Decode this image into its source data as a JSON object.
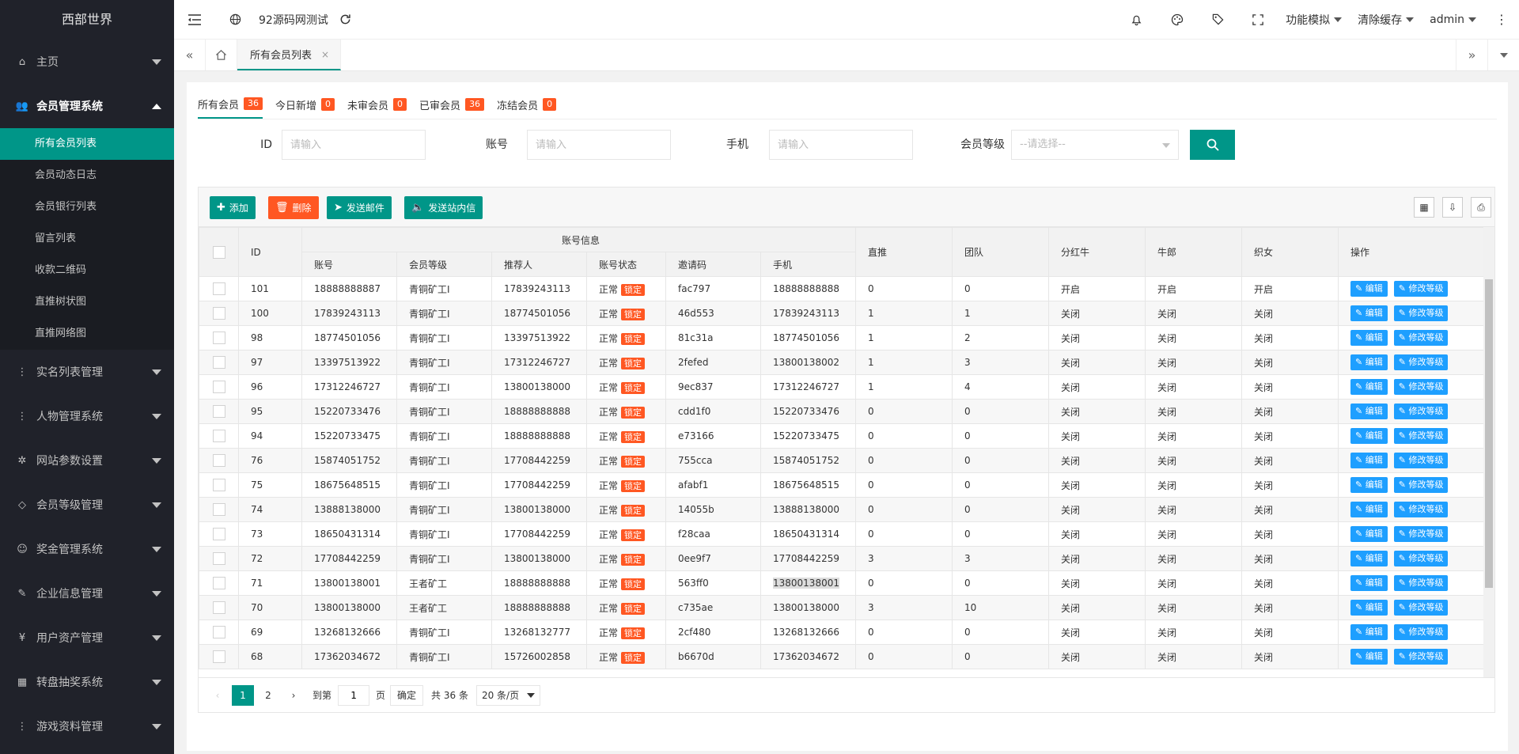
{
  "sidebar": {
    "logo": "西部世界",
    "items": [
      {
        "label": "主页",
        "icon": "home-icon",
        "glyph": "⌂"
      },
      {
        "label": "会员管理系统",
        "icon": "users-icon",
        "glyph": "👥",
        "open": true,
        "children": [
          "所有会员列表",
          "会员动态日志",
          "会员银行列表",
          "留言列表",
          "收款二维码",
          "直推树状图",
          "直推网络图"
        ]
      },
      {
        "label": "实名列表管理",
        "icon": "more-vertical-icon",
        "glyph": "⋮"
      },
      {
        "label": "人物管理系统",
        "icon": "more-vertical-icon",
        "glyph": "⋮"
      },
      {
        "label": "网站参数设置",
        "icon": "gear-icon",
        "glyph": "✲"
      },
      {
        "label": "会员等级管理",
        "icon": "diamond-icon",
        "glyph": "◇"
      },
      {
        "label": "奖金管理系统",
        "icon": "smile-icon",
        "glyph": "☺"
      },
      {
        "label": "企业信息管理",
        "icon": "edit-doc-icon",
        "glyph": "✎"
      },
      {
        "label": "用户资产管理",
        "icon": "yen-icon",
        "glyph": "¥"
      },
      {
        "label": "转盘抽奖系统",
        "icon": "apps-icon",
        "glyph": "▦"
      },
      {
        "label": "游戏资料管理",
        "icon": "more-vertical-icon",
        "glyph": "⋮"
      }
    ]
  },
  "header": {
    "site_title": "92源码网测试",
    "right": {
      "feature": "功能模拟",
      "clear_cache": "清除缓存",
      "user": "admin"
    }
  },
  "tabbar": {
    "active_tab": "所有会员列表",
    "close": "×"
  },
  "subtabs": [
    {
      "label": "所有会员",
      "count": "36"
    },
    {
      "label": "今日新增",
      "count": "0"
    },
    {
      "label": "未审会员",
      "count": "0"
    },
    {
      "label": "已审会员",
      "count": "36"
    },
    {
      "label": "冻结会员",
      "count": "0"
    }
  ],
  "search": {
    "id_label": "ID",
    "id_placeholder": "请输入",
    "account_label": "账号",
    "account_placeholder": "请输入",
    "phone_label": "手机",
    "phone_placeholder": "请输入",
    "level_label": "会员等级",
    "level_placeholder": "--请选择--"
  },
  "toolbar": {
    "add": "添加",
    "delete": "删除",
    "send_mail": "发送邮件",
    "send_msg": "发送站内信"
  },
  "table": {
    "group_header": "账号信息",
    "headers": {
      "id": "ID",
      "account": "账号",
      "level": "会员等级",
      "referrer": "推荐人",
      "status": "账号状态",
      "invite": "邀请码",
      "phone": "手机",
      "direct": "直推",
      "team": "团队",
      "bull": "分红牛",
      "herder": "牛郎",
      "weaver": "织女",
      "ops": "操作"
    },
    "lock_label": "锁定",
    "edit_label": "编辑",
    "level_edit_label": "修改等级",
    "rows": [
      {
        "id": "101",
        "account": "18888888887",
        "level": "青铜矿工I",
        "referrer": "17839243113",
        "status": "正常",
        "invite": "fac797",
        "phone": "18888888888",
        "direct": "0",
        "team": "0",
        "bull": "开启",
        "herder": "开启",
        "weaver": "开启"
      },
      {
        "id": "100",
        "account": "17839243113",
        "level": "青铜矿工I",
        "referrer": "18774501056",
        "status": "正常",
        "invite": "46d553",
        "phone": "17839243113",
        "direct": "1",
        "team": "1",
        "bull": "关闭",
        "herder": "关闭",
        "weaver": "关闭"
      },
      {
        "id": "98",
        "account": "18774501056",
        "level": "青铜矿工I",
        "referrer": "13397513922",
        "status": "正常",
        "invite": "81c31a",
        "phone": "18774501056",
        "direct": "1",
        "team": "2",
        "bull": "关闭",
        "herder": "关闭",
        "weaver": "关闭"
      },
      {
        "id": "97",
        "account": "13397513922",
        "level": "青铜矿工I",
        "referrer": "17312246727",
        "status": "正常",
        "invite": "2fefed",
        "phone": "13800138002",
        "direct": "1",
        "team": "3",
        "bull": "关闭",
        "herder": "关闭",
        "weaver": "关闭"
      },
      {
        "id": "96",
        "account": "17312246727",
        "level": "青铜矿工I",
        "referrer": "13800138000",
        "status": "正常",
        "invite": "9ec837",
        "phone": "17312246727",
        "direct": "1",
        "team": "4",
        "bull": "关闭",
        "herder": "关闭",
        "weaver": "关闭"
      },
      {
        "id": "95",
        "account": "15220733476",
        "level": "青铜矿工I",
        "referrer": "18888888888",
        "status": "正常",
        "invite": "cdd1f0",
        "phone": "15220733476",
        "direct": "0",
        "team": "0",
        "bull": "关闭",
        "herder": "关闭",
        "weaver": "关闭"
      },
      {
        "id": "94",
        "account": "15220733475",
        "level": "青铜矿工I",
        "referrer": "18888888888",
        "status": "正常",
        "invite": "e73166",
        "phone": "15220733475",
        "direct": "0",
        "team": "0",
        "bull": "关闭",
        "herder": "关闭",
        "weaver": "关闭"
      },
      {
        "id": "76",
        "account": "15874051752",
        "level": "青铜矿工I",
        "referrer": "17708442259",
        "status": "正常",
        "invite": "755cca",
        "phone": "15874051752",
        "direct": "0",
        "team": "0",
        "bull": "关闭",
        "herder": "关闭",
        "weaver": "关闭"
      },
      {
        "id": "75",
        "account": "18675648515",
        "level": "青铜矿工I",
        "referrer": "17708442259",
        "status": "正常",
        "invite": "afabf1",
        "phone": "18675648515",
        "direct": "0",
        "team": "0",
        "bull": "关闭",
        "herder": "关闭",
        "weaver": "关闭"
      },
      {
        "id": "74",
        "account": "13888138000",
        "level": "青铜矿工I",
        "referrer": "13800138000",
        "status": "正常",
        "invite": "14055b",
        "phone": "13888138000",
        "direct": "0",
        "team": "0",
        "bull": "关闭",
        "herder": "关闭",
        "weaver": "关闭"
      },
      {
        "id": "73",
        "account": "18650431314",
        "level": "青铜矿工I",
        "referrer": "17708442259",
        "status": "正常",
        "invite": "f28caa",
        "phone": "18650431314",
        "direct": "0",
        "team": "0",
        "bull": "关闭",
        "herder": "关闭",
        "weaver": "关闭"
      },
      {
        "id": "72",
        "account": "17708442259",
        "level": "青铜矿工I",
        "referrer": "13800138000",
        "status": "正常",
        "invite": "0ee9f7",
        "phone": "17708442259",
        "direct": "3",
        "team": "3",
        "bull": "关闭",
        "herder": "关闭",
        "weaver": "关闭"
      },
      {
        "id": "71",
        "account": "13800138001",
        "level": "王者矿工",
        "referrer": "18888888888",
        "status": "正常",
        "invite": "563ff0",
        "phone": "13800138001",
        "direct": "0",
        "team": "0",
        "bull": "关闭",
        "herder": "关闭",
        "weaver": "关闭",
        "highlight_phone": true
      },
      {
        "id": "70",
        "account": "13800138000",
        "level": "王者矿工",
        "referrer": "18888888888",
        "status": "正常",
        "invite": "c735ae",
        "phone": "13800138000",
        "direct": "3",
        "team": "10",
        "bull": "关闭",
        "herder": "关闭",
        "weaver": "关闭"
      },
      {
        "id": "69",
        "account": "13268132666",
        "level": "青铜矿工I",
        "referrer": "13268132777",
        "status": "正常",
        "invite": "2cf480",
        "phone": "13268132666",
        "direct": "0",
        "team": "0",
        "bull": "关闭",
        "herder": "关闭",
        "weaver": "关闭"
      },
      {
        "id": "68",
        "account": "17362034672",
        "level": "青铜矿工I",
        "referrer": "15726002858",
        "status": "正常",
        "invite": "b6670d",
        "phone": "17362034672",
        "direct": "0",
        "team": "0",
        "bull": "关闭",
        "herder": "关闭",
        "weaver": "关闭"
      }
    ]
  },
  "pager": {
    "prev": "‹",
    "pages": [
      "1",
      "2"
    ],
    "next": "›",
    "goto": "到第",
    "page_input": "1",
    "page_unit": "页",
    "confirm": "确定",
    "total": "共 36 条",
    "size": "20 条/页"
  },
  "colors": {
    "primary": "#009688",
    "danger": "#ff5722",
    "info": "#1e9fff",
    "sidebar": "#20222a"
  }
}
